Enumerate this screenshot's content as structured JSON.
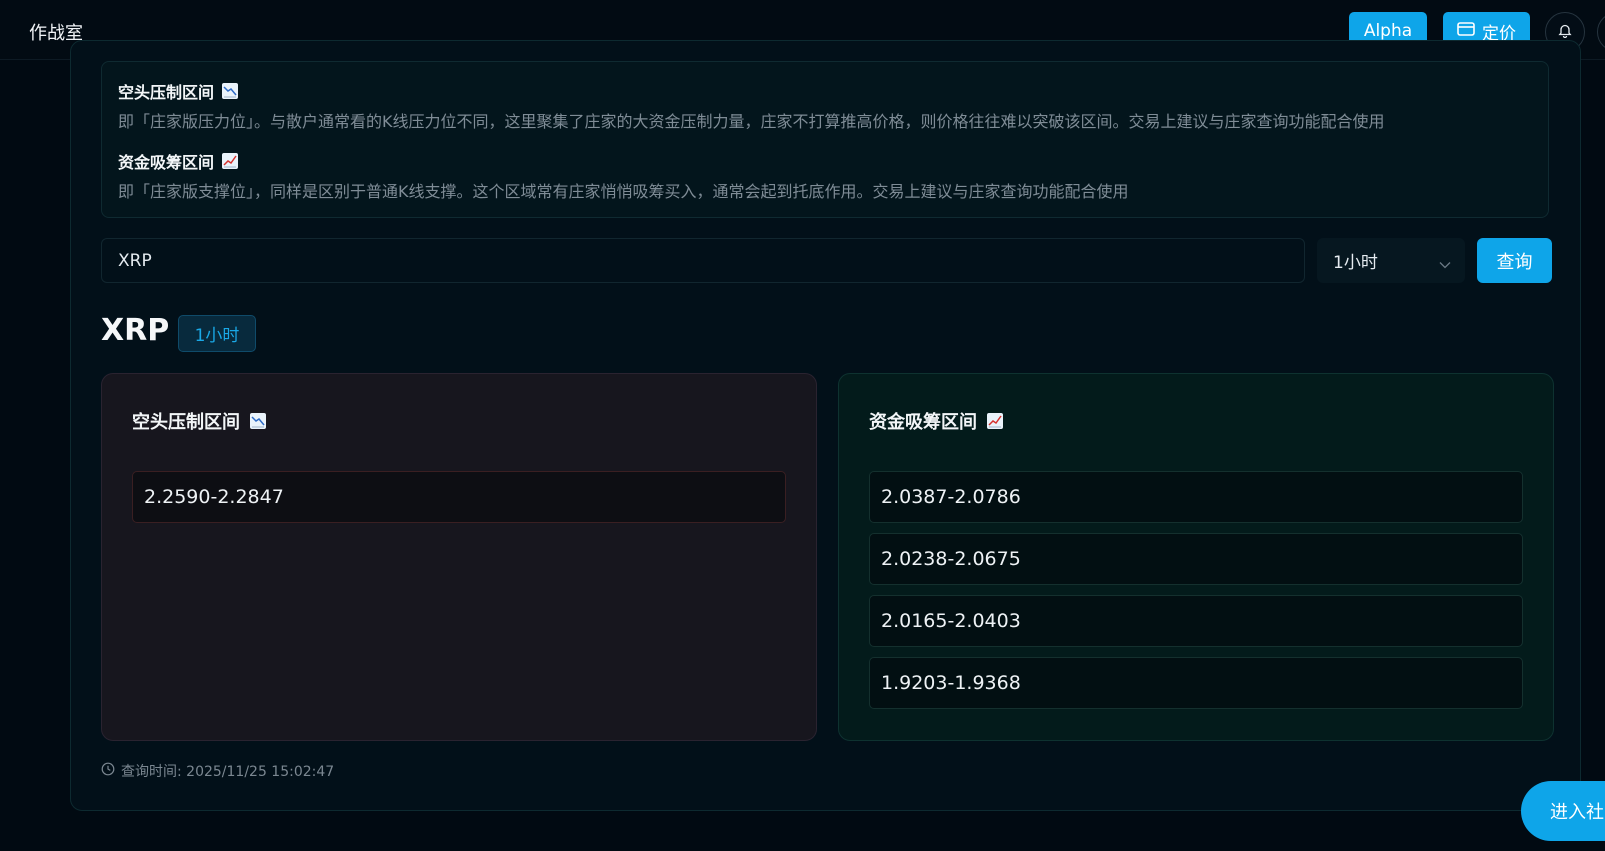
{
  "header": {
    "app_title": "作战室",
    "alpha_label": "Alpha",
    "pricing_label": "定价"
  },
  "info": {
    "short_title": "空头压制区间",
    "short_desc": "即「庄家版压力位」。与散户通常看的K线压力位不同，这里聚集了庄家的大资金压制力量，庄家不打算推高价格，则价格往往难以突破该区间。交易上建议与庄家查询功能配合使用",
    "long_title": "资金吸筹区间",
    "long_desc": "即「庄家版支撑位」，同样是区别于普通K线支撑。这个区域常有庄家悄悄吸筹买入，通常会起到托底作用。交易上建议与庄家查询功能配合使用"
  },
  "search": {
    "symbol_value": "XRP",
    "interval_value": "1小时",
    "query_label": "查询"
  },
  "result": {
    "symbol": "XRP",
    "interval": "1小时",
    "short_panel": {
      "title": "空头压制区间",
      "ranges": [
        "2.2590-2.2847"
      ]
    },
    "long_panel": {
      "title": "资金吸筹区间",
      "ranges": [
        "2.0387-2.0786",
        "2.0238-2.0675",
        "2.0165-2.0403",
        "1.9203-1.9368"
      ]
    },
    "query_time": "查询时间: 2025/11/25 15:02:47"
  },
  "floating": {
    "community_label": "进入社区"
  },
  "icons": {
    "short_emoji": "chart-decreasing-icon",
    "long_emoji": "chart-increasing-icon",
    "bell": "bell-icon",
    "card": "credit-card-icon",
    "clock": "clock-icon"
  },
  "colors": {
    "accent": "#0ea5e9",
    "background": "#010a12",
    "short_panel_bg": "#17161e",
    "long_panel_bg": "#031b1b"
  }
}
